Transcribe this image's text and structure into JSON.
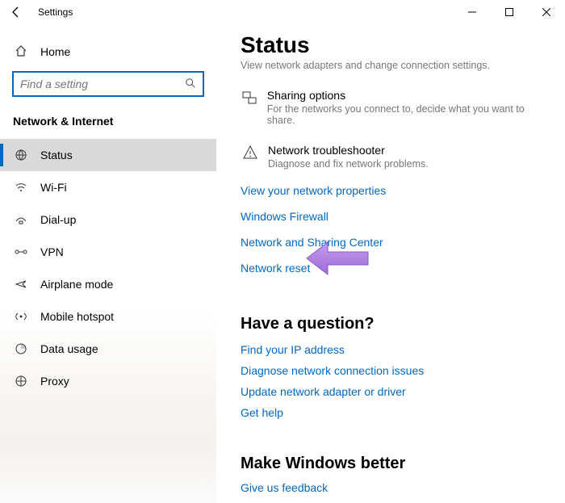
{
  "window": {
    "title": "Settings"
  },
  "sidebar": {
    "home_label": "Home",
    "search_placeholder": "Find a setting",
    "category": "Network & Internet",
    "items": [
      {
        "label": "Status"
      },
      {
        "label": "Wi-Fi"
      },
      {
        "label": "Dial-up"
      },
      {
        "label": "VPN"
      },
      {
        "label": "Airplane mode"
      },
      {
        "label": "Mobile hotspot"
      },
      {
        "label": "Data usage"
      },
      {
        "label": "Proxy"
      }
    ]
  },
  "main": {
    "page_title": "Status",
    "partial_top": "View network adapters and change connection settings.",
    "sharing": {
      "title": "Sharing options",
      "sub": "For the networks you connect to, decide what you want to share."
    },
    "troubleshoot": {
      "title": "Network troubleshooter",
      "sub": "Diagnose and fix network problems."
    },
    "links": {
      "view_props": "View your network properties",
      "firewall": "Windows Firewall",
      "sharing_center": "Network and Sharing Center",
      "reset": "Network reset"
    },
    "question": {
      "heading": "Have a question?",
      "ip": "Find your IP address",
      "diag": "Diagnose network connection issues",
      "upd": "Update network adapter or driver",
      "help": "Get help"
    },
    "better": {
      "heading": "Make Windows better",
      "feedback": "Give us feedback"
    }
  },
  "colors": {
    "accent": "#0067c0",
    "arrow": "#b181e8"
  }
}
